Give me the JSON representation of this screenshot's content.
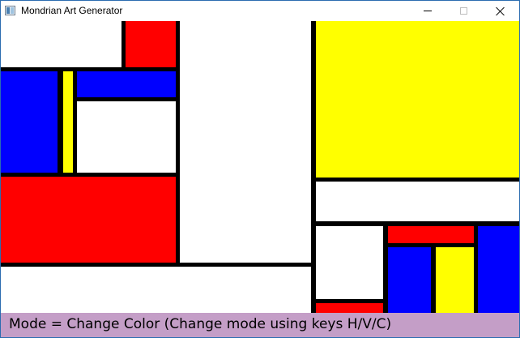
{
  "window": {
    "title": "Mondrian Art Generator",
    "icon": "app-icon"
  },
  "palette": {
    "red": "#ff0000",
    "blue": "#0000ff",
    "yellow": "#ffff00",
    "white": "#ffffff",
    "black": "#000000",
    "status_bg": "#c49ec7"
  },
  "canvas": {
    "cells": [
      {
        "color": "white"
      },
      {
        "color": "red"
      },
      {
        "color": "blue"
      },
      {
        "color": "yellow"
      },
      {
        "color": "blue"
      },
      {
        "color": "white"
      },
      {
        "color": "red"
      },
      {
        "color": "white"
      },
      {
        "color": "white"
      },
      {
        "color": "yellow"
      },
      {
        "color": "white"
      },
      {
        "color": "white"
      },
      {
        "color": "red"
      },
      {
        "color": "red"
      },
      {
        "color": "blue"
      },
      {
        "color": "yellow"
      },
      {
        "color": "blue"
      },
      {
        "color": "red"
      }
    ]
  },
  "status": {
    "text": "Mode = Change Color (Change mode using keys H/V/C)"
  }
}
